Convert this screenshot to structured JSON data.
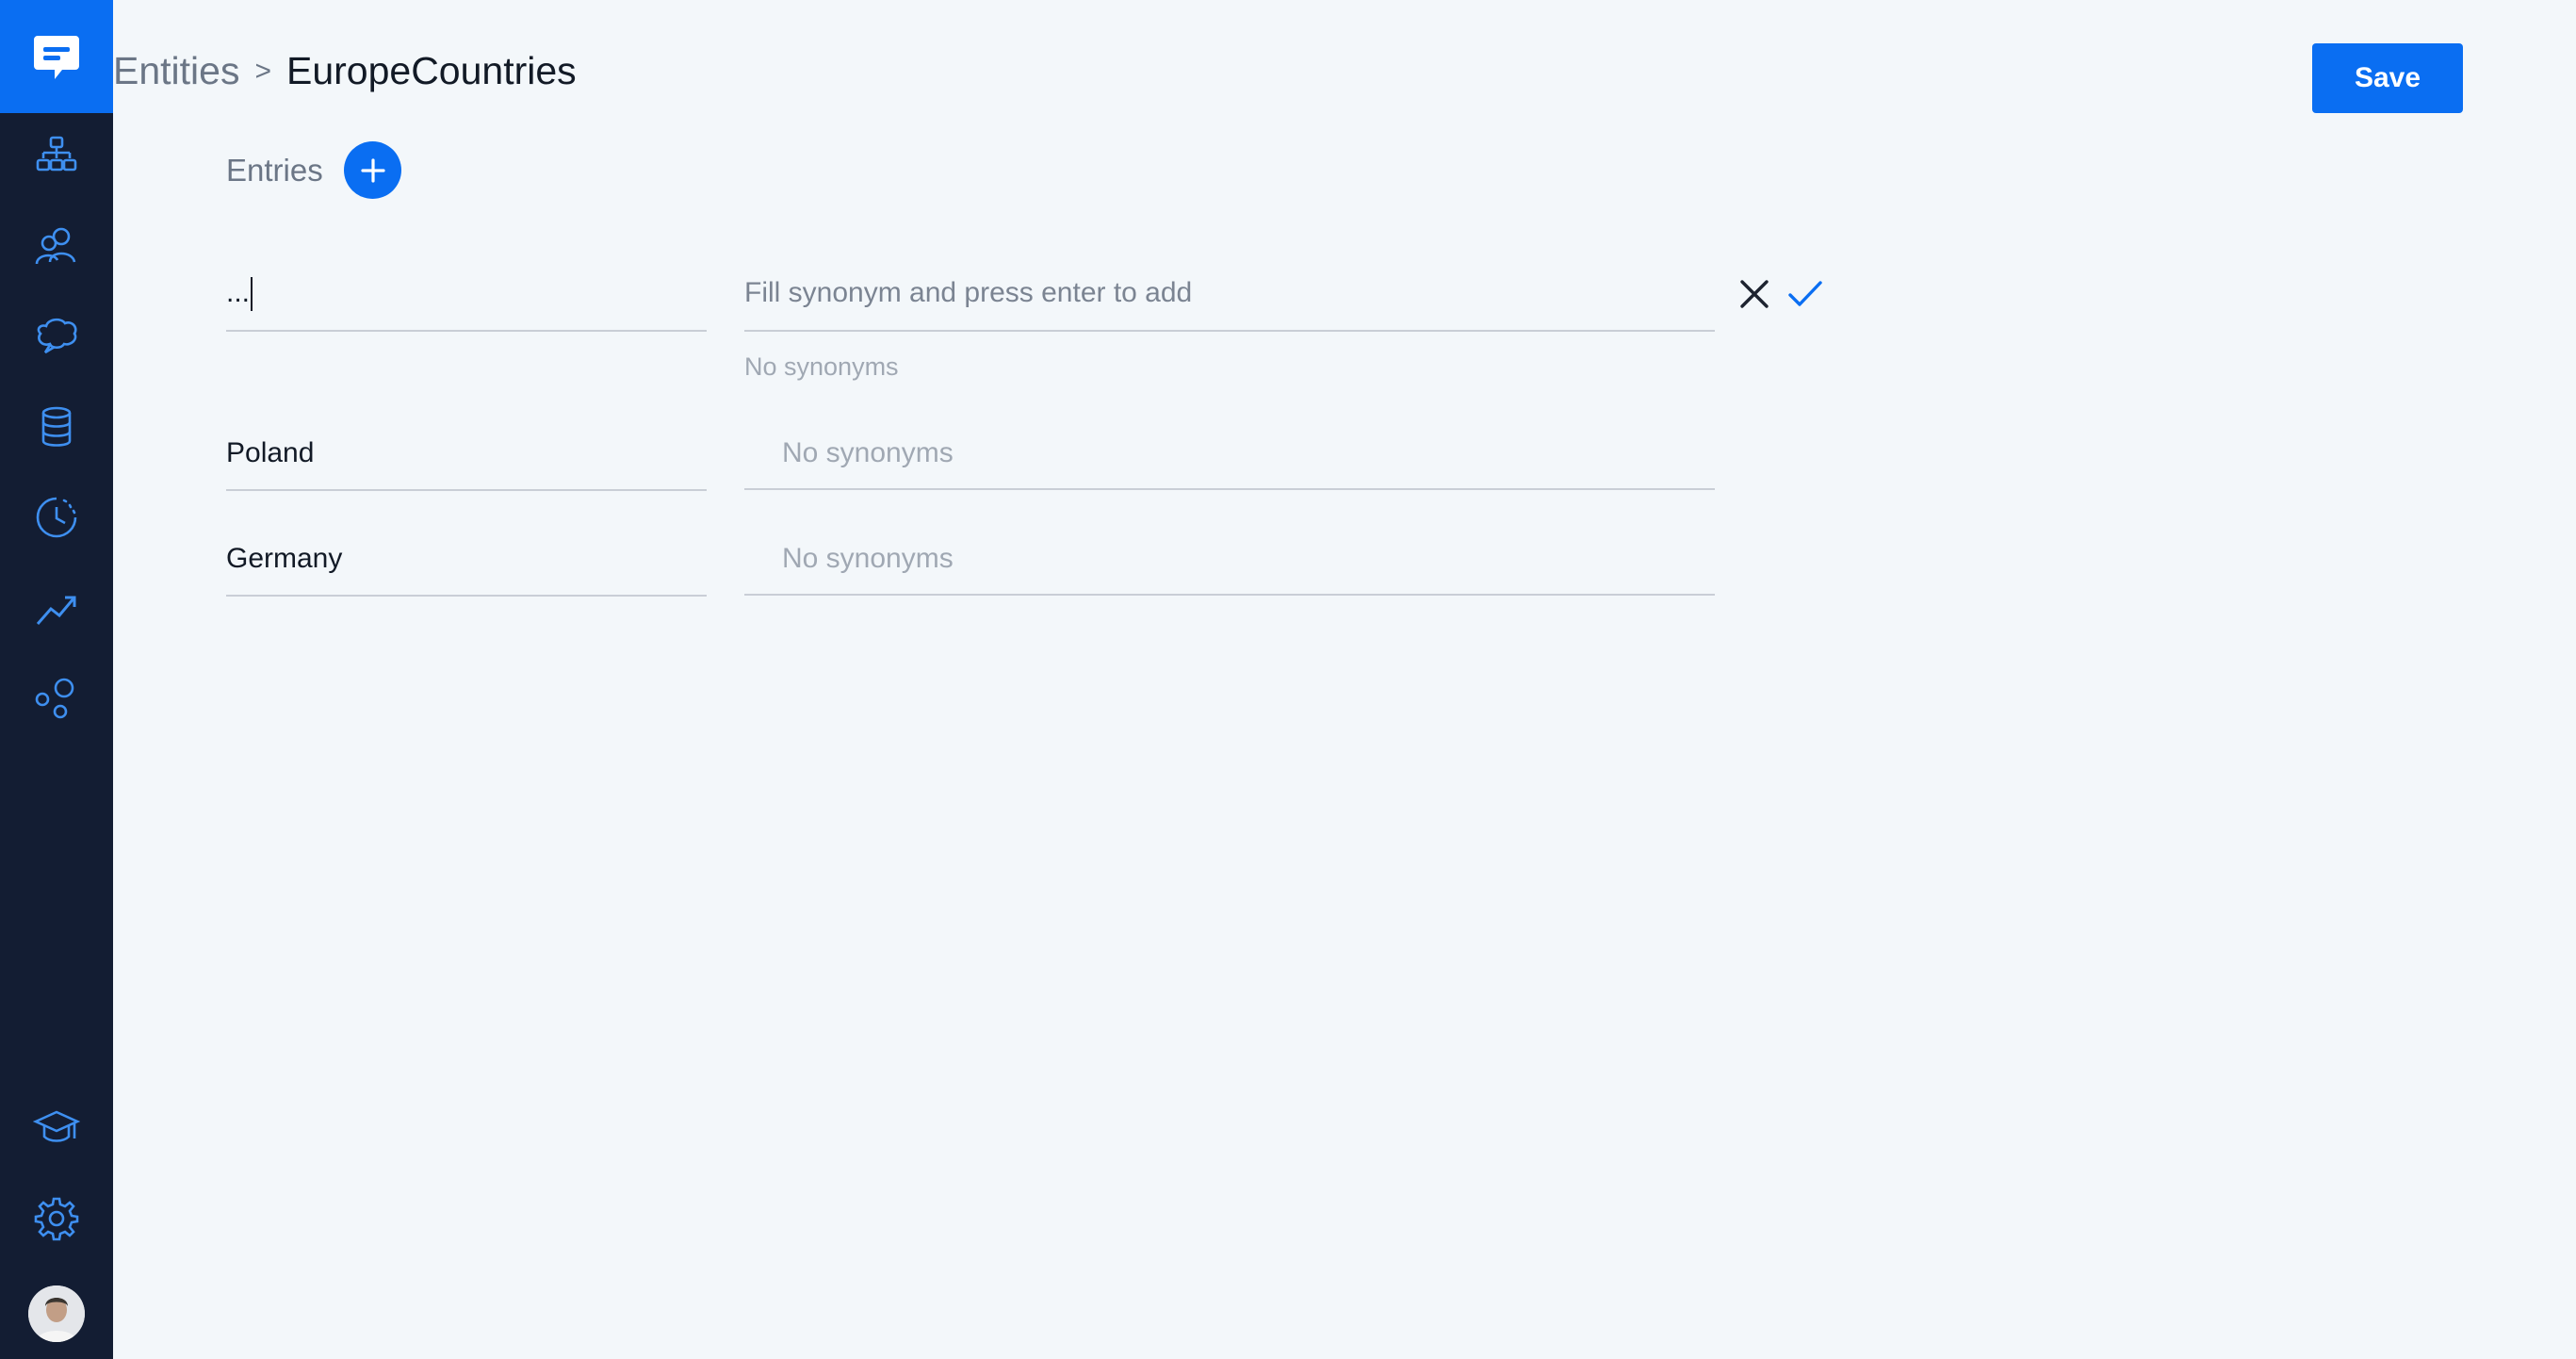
{
  "nav": {
    "items": [
      {
        "name": "flows-icon"
      },
      {
        "name": "users-icon"
      },
      {
        "name": "chat-bubble-icon"
      },
      {
        "name": "database-icon"
      },
      {
        "name": "history-icon"
      },
      {
        "name": "analytics-icon"
      },
      {
        "name": "integrations-icon"
      },
      {
        "name": "learn-icon"
      },
      {
        "name": "settings-icon"
      }
    ]
  },
  "breadcrumb": {
    "parent": "Entities",
    "separator": ">",
    "current": "EuropeCountries"
  },
  "toolbar": {
    "save_label": "Save"
  },
  "entries": {
    "label": "Entries",
    "new_entry": {
      "value": "...",
      "synonym_placeholder": "Fill synonym and press enter to add",
      "synonyms_note": "No synonyms"
    },
    "rows": [
      {
        "name": "Poland",
        "synonyms": "No synonyms"
      },
      {
        "name": "Germany",
        "synonyms": "No synonyms"
      }
    ]
  },
  "colors": {
    "sidebar": "#131d33",
    "accent": "#0a6ef2",
    "background": "#f3f7fa"
  }
}
